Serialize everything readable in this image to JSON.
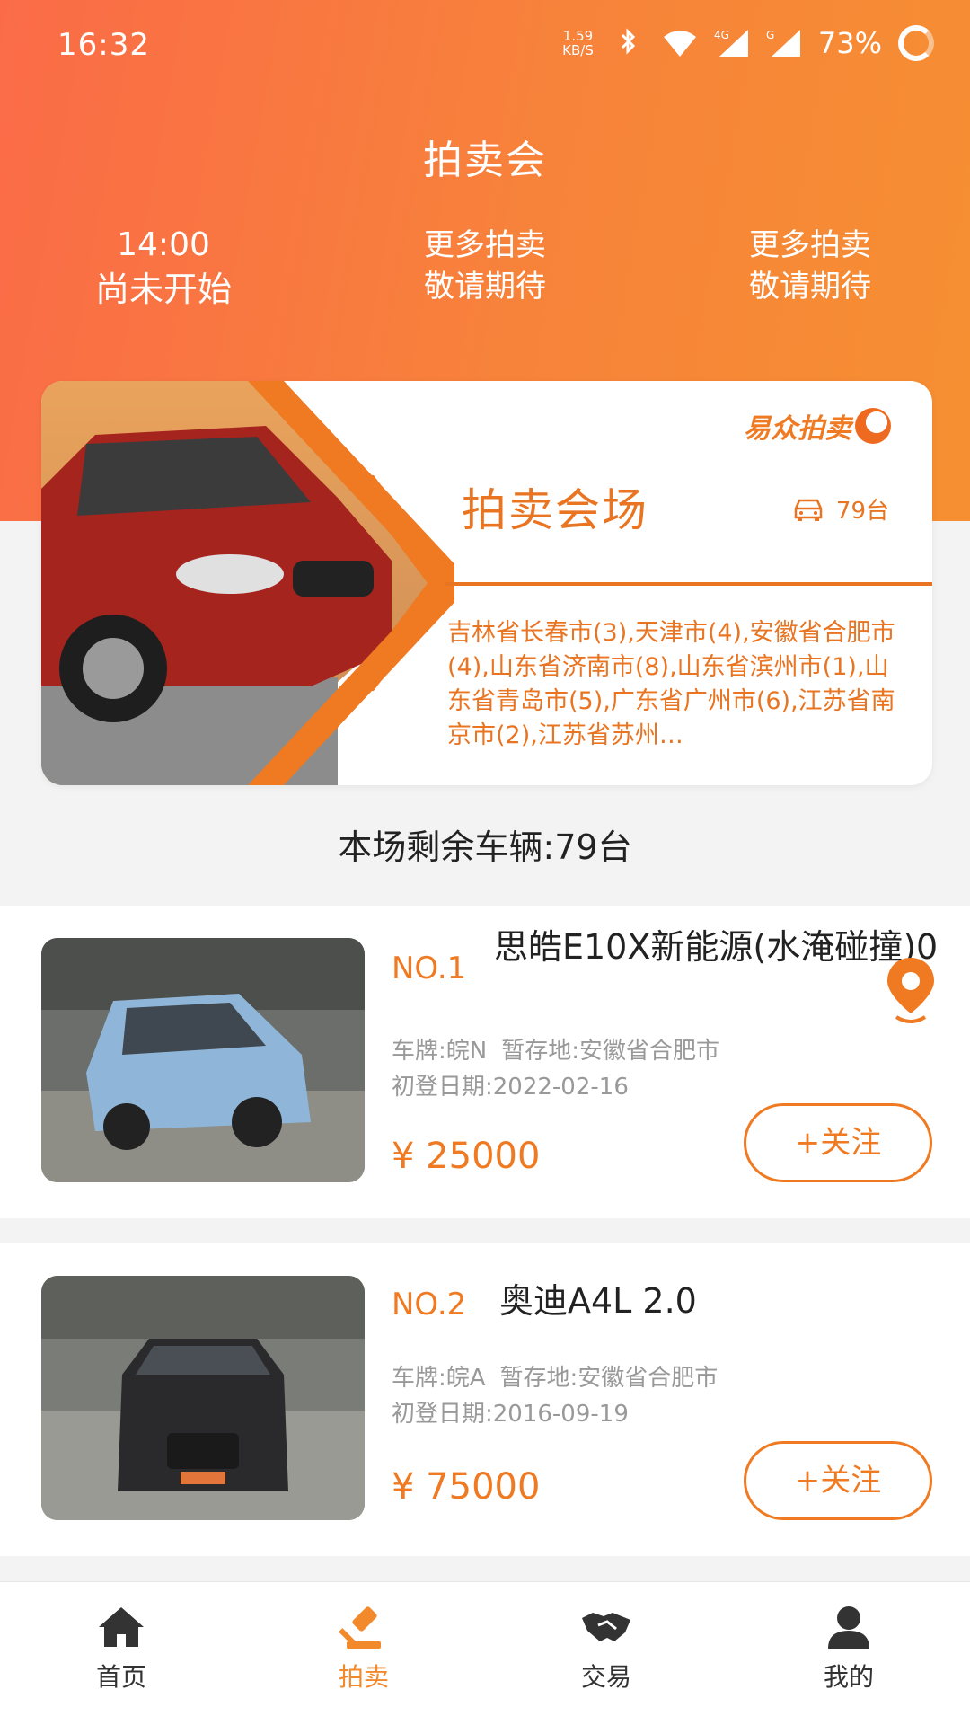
{
  "status_bar": {
    "time": "16:32",
    "net_speed_value": "1.59",
    "net_speed_unit": "KB/S",
    "battery": "73%"
  },
  "header": {
    "title": "拍卖会",
    "sessions": [
      {
        "line1": "14:00",
        "line2": "尚未开始"
      },
      {
        "line1": "更多拍卖",
        "line2": "敬请期待"
      },
      {
        "line1": "更多拍卖",
        "line2": "敬请期待"
      }
    ]
  },
  "banner": {
    "brand": "易众拍卖",
    "title": "拍卖会场",
    "count": "79台",
    "cities": "吉林省长春市(3),天津市(4),安徽省合肥市(4),山东省济南市(8),山东省滨州市(1),山东省青岛市(5),广东省广州市(6),江苏省南京市(2),江苏省苏州…"
  },
  "remaining": "本场剩余车辆:79台",
  "vehicles": [
    {
      "no": "NO.1",
      "name": "思皓E10X新能源(水淹碰撞)0",
      "plate": "车牌:皖N",
      "storage": "暂存地:安徽省合肥市",
      "reg_date": "初登日期:2022-02-16",
      "price": "¥ 25000",
      "follow": "+关注"
    },
    {
      "no": "NO.2",
      "name": "奥迪A4L 2.0",
      "plate": "车牌:皖A",
      "storage": "暂存地:安徽省合肥市",
      "reg_date": "初登日期:2016-09-19",
      "price": "¥ 75000",
      "follow": "+关注"
    }
  ],
  "nav": [
    {
      "label": "首页",
      "icon": "home-icon"
    },
    {
      "label": "拍卖",
      "icon": "gavel-icon"
    },
    {
      "label": "交易",
      "icon": "handshake-icon"
    },
    {
      "label": "我的",
      "icon": "user-icon"
    }
  ],
  "colors": {
    "accent": "#ef7a22",
    "header_start": "#fb6b48",
    "header_end": "#f68f32",
    "nav_active": "#f28a2c"
  }
}
